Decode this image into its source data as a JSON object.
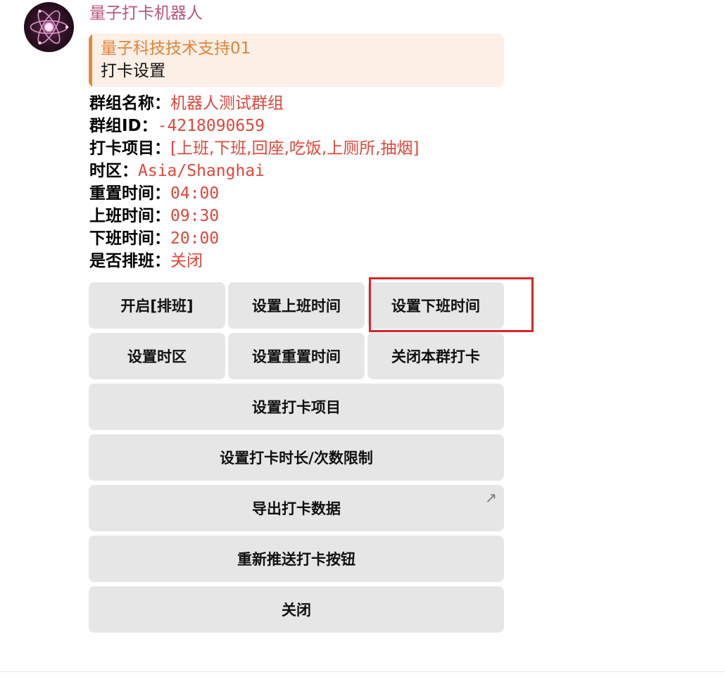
{
  "bot": {
    "name": "量子打卡机器人",
    "avatar_icon": "atom-icon"
  },
  "reply": {
    "author": "量子科技技术支持01",
    "text": "打卡设置"
  },
  "info": [
    {
      "label": "群组名称：",
      "value": "机器人测试群组"
    },
    {
      "label": "群组ID：",
      "value": "-4218090659"
    },
    {
      "label": "打卡项目：",
      "value": "[上班,下班,回座,吃饭,上厕所,抽烟]"
    },
    {
      "label": "时区：",
      "value": "Asia/Shanghai"
    },
    {
      "label": "重置时间：",
      "value": "04:00"
    },
    {
      "label": "上班时间：",
      "value": "09:30"
    },
    {
      "label": "下班时间：",
      "value": "20:00"
    },
    {
      "label": "是否排班：",
      "value": "关闭"
    }
  ],
  "buttons": {
    "enable_schedule": "开启[排班]",
    "set_work_start": "设置上班时间",
    "set_work_end": "设置下班时间",
    "set_timezone": "设置时区",
    "set_reset_time": "设置重置时间",
    "close_group_checkin": "关闭本群打卡",
    "set_checkin_items": "设置打卡项目",
    "set_duration_limit": "设置打卡时长/次数限制",
    "export_data": "导出打卡数据",
    "repush_buttons": "重新推送打卡按钮",
    "close": "关闭"
  },
  "icons": {
    "export_link": "arrow-up-right-icon"
  },
  "colors": {
    "sender_name": "#b8557f",
    "reply_accent": "#e08a3a",
    "reply_background": "#fbefe6",
    "value_text": "#e0463a",
    "button_background": "#e6e6e6",
    "highlight_border": "#d8242a"
  }
}
